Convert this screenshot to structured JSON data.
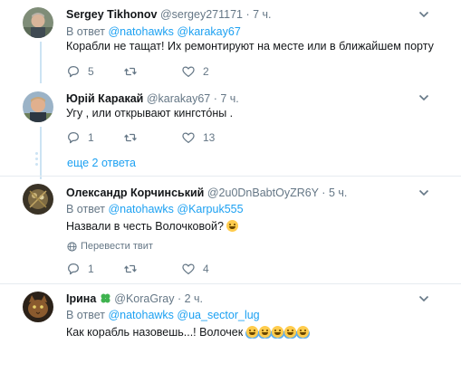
{
  "tweets": [
    {
      "name": "Sergey Tikhonov",
      "handle": "@sergey271171",
      "dot": "·",
      "time": "7 ч.",
      "reply_prefix": "В ответ",
      "reply_to": [
        "@natohawks",
        "@karakay67"
      ],
      "text": "Корабли не тащат! Их ремонтируют на месте или в ближайшем порту",
      "replies": "5",
      "retweets": "",
      "likes": "2"
    },
    {
      "name": "Юрій Каракай",
      "handle": "@karakay67",
      "dot": "·",
      "time": "7 ч.",
      "text": "Угу , или открывают кингсто́ны .",
      "replies": "1",
      "retweets": "",
      "likes": "13"
    },
    {
      "name": "Олександр Корчинський",
      "handle": "@2u0DnBabtOyZR6Y",
      "dot": "·",
      "time": "5 ч.",
      "reply_prefix": "В ответ",
      "reply_to": [
        "@natohawks",
        "@Karpuk555"
      ],
      "text": "Назвали в честь Волочковой?",
      "translate": "Перевести твит",
      "replies": "1",
      "retweets": "",
      "likes": "4"
    },
    {
      "name": "Ірина",
      "handle": "@KoraGray",
      "dot": "·",
      "time": "2 ч.",
      "reply_prefix": "В ответ",
      "reply_to": [
        "@natohawks",
        "@ua_sector_lug"
      ],
      "text": "Как корабль назовешь...! Волочек"
    }
  ],
  "more_replies": "еще 2 ответа",
  "colors": {
    "link": "#1da1f2",
    "muted": "#657786",
    "thread": "#cce3f3",
    "divider": "#e6ecf0",
    "clover": "#3fb34f"
  },
  "icons": {
    "reply": "speech-bubble-icon",
    "retweet": "retweet-arrows-icon",
    "like": "heart-icon",
    "more": "chevron-down-icon",
    "translate": "globe-icon",
    "emoji_grin": "grinning-face-emoji",
    "emoji_tears": "face-with-tears-of-joy-emoji",
    "name_badge": "four-leaf-clover-emoji"
  }
}
